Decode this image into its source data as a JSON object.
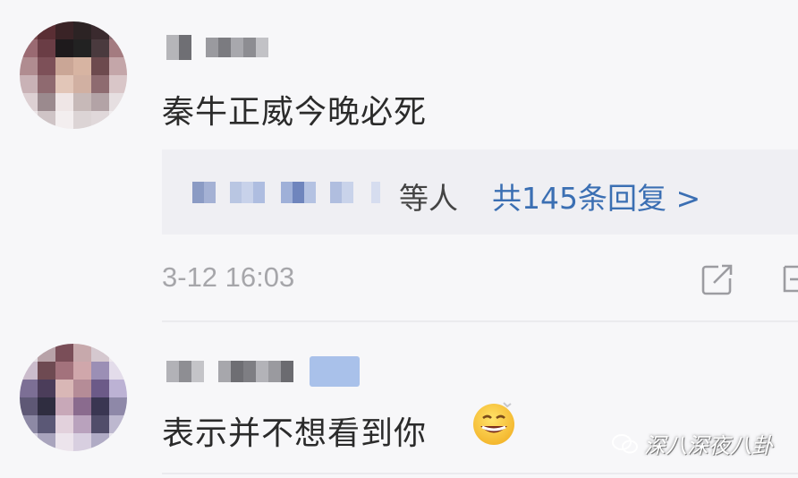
{
  "comments": [
    {
      "text": "秦牛正威今晚必死",
      "reply_suffix": "等人",
      "reply_count_text": "共145条回复 >",
      "time": "3-12 16:03"
    },
    {
      "text": "表示并不想看到你"
    }
  ],
  "icons": {
    "share": "share-icon",
    "emoji": "grinning-emoji-icon",
    "more": "more-icon"
  },
  "watermark": {
    "text": "深八深夜八卦"
  },
  "colors": {
    "link": "#3b6fb3",
    "muted": "#a6a6aa",
    "background": "#f7f7f9",
    "reply_bg": "#efeff3"
  }
}
